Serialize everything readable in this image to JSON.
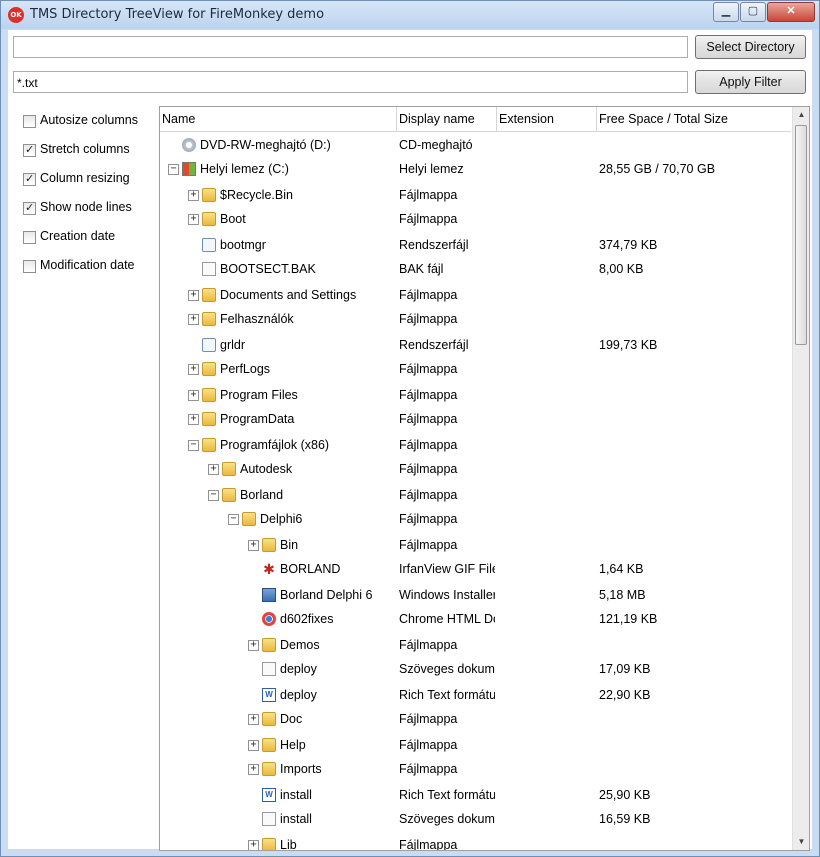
{
  "window": {
    "title": "TMS Directory TreeView for FireMonkey demo",
    "icon_text": "OK",
    "min_label": "▁",
    "max_label": "▢",
    "close_label": "✕"
  },
  "toolbar": {
    "directory_value": "",
    "filter_value": "*.txt",
    "select_directory_label": "Select Directory",
    "apply_filter_label": "Apply Filter"
  },
  "options": [
    {
      "label": "Autosize columns",
      "checked": false
    },
    {
      "label": "Stretch columns",
      "checked": true
    },
    {
      "label": "Column resizing",
      "checked": true
    },
    {
      "label": "Show node lines",
      "checked": true
    },
    {
      "label": "Creation date",
      "checked": false
    },
    {
      "label": "Modification date",
      "checked": false
    }
  ],
  "columns": [
    "Name",
    "Display name",
    "Extension",
    "Free Space / Total Size"
  ],
  "rows": [
    {
      "name": "DVD-RW-meghajtó (D:)",
      "display": "CD-meghajtó",
      "ext": "",
      "size": "",
      "level": 0,
      "expander": "",
      "icon": "cd-drive-icon"
    },
    {
      "name": "Helyi lemez (C:)",
      "display": "Helyi lemez",
      "ext": "",
      "size": "28,55 GB / 70,70 GB",
      "level": 0,
      "expander": "−",
      "icon": "system-drive-icon"
    },
    {
      "name": "$Recycle.Bin",
      "display": "Fájlmappa",
      "ext": "",
      "size": "",
      "level": 1,
      "expander": "+",
      "icon": "folder-icon"
    },
    {
      "name": "Boot",
      "display": "Fájlmappa",
      "ext": "",
      "size": "",
      "level": 1,
      "expander": "+",
      "icon": "folder-icon"
    },
    {
      "name": "bootmgr",
      "display": "Rendszerfájl",
      "ext": "",
      "size": "374,79 KB",
      "level": 1,
      "expander": "",
      "icon": "system-file-icon"
    },
    {
      "name": "BOOTSECT.BAK",
      "display": "BAK fájl",
      "ext": "",
      "size": "8,00 KB",
      "level": 1,
      "expander": "",
      "icon": "document-icon"
    },
    {
      "name": "Documents and Settings",
      "display": "Fájlmappa",
      "ext": "",
      "size": "",
      "level": 1,
      "expander": "+",
      "icon": "folder-shortcut-icon"
    },
    {
      "name": "Felhasználók",
      "display": "Fájlmappa",
      "ext": "",
      "size": "",
      "level": 1,
      "expander": "+",
      "icon": "folder-icon"
    },
    {
      "name": "grldr",
      "display": "Rendszerfájl",
      "ext": "",
      "size": "199,73 KB",
      "level": 1,
      "expander": "",
      "icon": "system-file-icon"
    },
    {
      "name": "PerfLogs",
      "display": "Fájlmappa",
      "ext": "",
      "size": "",
      "level": 1,
      "expander": "+",
      "icon": "folder-icon"
    },
    {
      "name": "Program Files",
      "display": "Fájlmappa",
      "ext": "",
      "size": "",
      "level": 1,
      "expander": "+",
      "icon": "folder-icon"
    },
    {
      "name": "ProgramData",
      "display": "Fájlmappa",
      "ext": "",
      "size": "",
      "level": 1,
      "expander": "+",
      "icon": "folder-icon"
    },
    {
      "name": "Programfájlok (x86)",
      "display": "Fájlmappa",
      "ext": "",
      "size": "",
      "level": 1,
      "expander": "−",
      "icon": "folder-icon"
    },
    {
      "name": "Autodesk",
      "display": "Fájlmappa",
      "ext": "",
      "size": "",
      "level": 2,
      "expander": "+",
      "icon": "folder-icon"
    },
    {
      "name": "Borland",
      "display": "Fájlmappa",
      "ext": "",
      "size": "",
      "level": 2,
      "expander": "−",
      "icon": "folder-icon"
    },
    {
      "name": "Delphi6",
      "display": "Fájlmappa",
      "ext": "",
      "size": "",
      "level": 3,
      "expander": "−",
      "icon": "folder-icon"
    },
    {
      "name": "Bin",
      "display": "Fájlmappa",
      "ext": "",
      "size": "",
      "level": 4,
      "expander": "+",
      "icon": "folder-icon"
    },
    {
      "name": "BORLAND",
      "display": "IrfanView GIF File",
      "ext": "",
      "size": "1,64 KB",
      "level": 4,
      "expander": "",
      "icon": "gif-image-icon"
    },
    {
      "name": "Borland Delphi 6",
      "display": "Windows Installer",
      "ext": "",
      "size": "5,18 MB",
      "level": 4,
      "expander": "",
      "icon": "installer-icon"
    },
    {
      "name": "d602fixes",
      "display": "Chrome HTML Do",
      "ext": "",
      "size": "121,19 KB",
      "level": 4,
      "expander": "",
      "icon": "chrome-html-icon"
    },
    {
      "name": "Demos",
      "display": "Fájlmappa",
      "ext": "",
      "size": "",
      "level": 4,
      "expander": "+",
      "icon": "folder-icon"
    },
    {
      "name": "deploy",
      "display": "Szöveges dokume",
      "ext": "",
      "size": "17,09 KB",
      "level": 4,
      "expander": "",
      "icon": "text-document-icon"
    },
    {
      "name": "deploy",
      "display": "Rich Text formátur",
      "ext": "",
      "size": "22,90 KB",
      "level": 4,
      "expander": "",
      "icon": "rtf-document-icon"
    },
    {
      "name": "Doc",
      "display": "Fájlmappa",
      "ext": "",
      "size": "",
      "level": 4,
      "expander": "+",
      "icon": "folder-icon"
    },
    {
      "name": "Help",
      "display": "Fájlmappa",
      "ext": "",
      "size": "",
      "level": 4,
      "expander": "+",
      "icon": "folder-icon"
    },
    {
      "name": "Imports",
      "display": "Fájlmappa",
      "ext": "",
      "size": "",
      "level": 4,
      "expander": "+",
      "icon": "folder-icon"
    },
    {
      "name": "install",
      "display": "Rich Text formátur",
      "ext": "",
      "size": "25,90 KB",
      "level": 4,
      "expander": "",
      "icon": "rtf-document-icon"
    },
    {
      "name": "install",
      "display": "Szöveges dokume",
      "ext": "",
      "size": "16,59 KB",
      "level": 4,
      "expander": "",
      "icon": "text-document-icon"
    },
    {
      "name": "Lib",
      "display": "Fájlmappa",
      "ext": "",
      "size": "",
      "level": 4,
      "expander": "+",
      "icon": "folder-icon"
    }
  ]
}
